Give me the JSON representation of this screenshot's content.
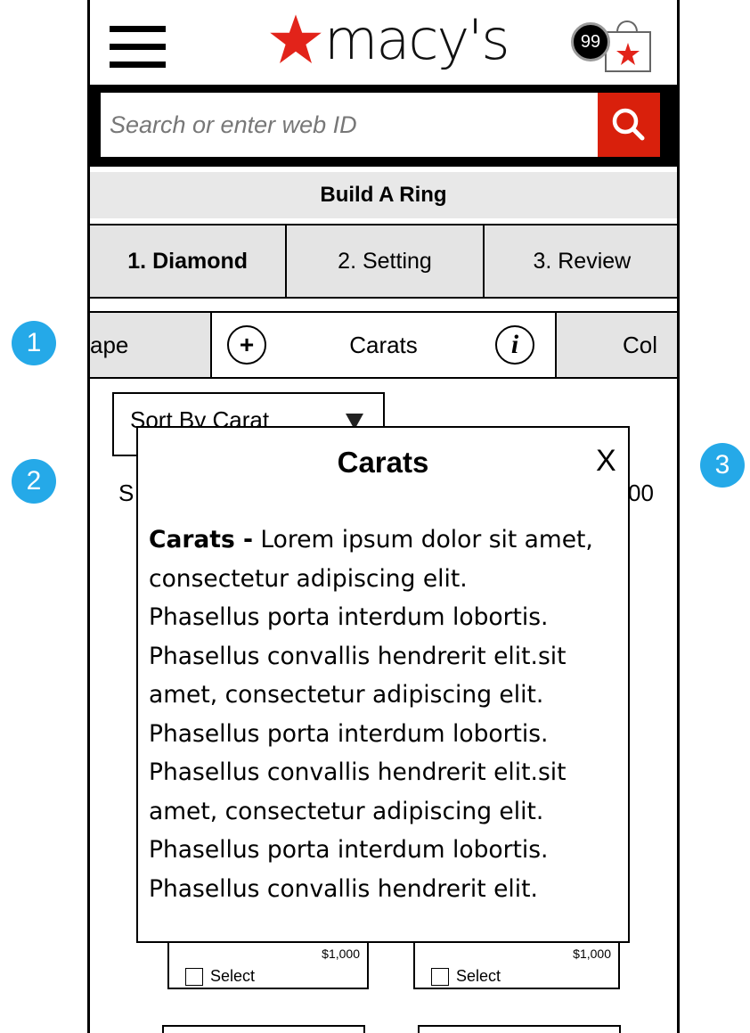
{
  "header": {
    "logo_text": "macy's",
    "bag_count": "99",
    "brand_red": "#d9200c"
  },
  "search": {
    "placeholder": "Search or enter web ID"
  },
  "page_title": "Build A Ring",
  "steps": [
    "1. Diamond",
    "2. Setting",
    "3. Review"
  ],
  "filters": {
    "shape_partial": "ape",
    "carats_label": "Carats",
    "color_partial": "Col"
  },
  "sort": {
    "label": "Sort By Carat"
  },
  "peek": {
    "left": "S",
    "right": "00"
  },
  "modal": {
    "title": "Carats",
    "close_label": "X",
    "lead": "Carats -",
    "lines": [
      " Lorem ipsum dolor sit amet,",
      "consectetur adipiscing elit.",
      "Phasellus porta interdum lobortis.",
      "Phasellus convallis hendrerit elit.sit",
      "amet, consectetur adipiscing elit.",
      "Phasellus porta interdum lobortis.",
      "Phasellus convallis hendrerit elit.sit",
      "amet, consectetur adipiscing elit.",
      "Phasellus porta interdum lobortis.",
      "Phasellus convallis hendrerit elit."
    ]
  },
  "products": [
    {
      "price": "$1,000",
      "select_label": "Select"
    },
    {
      "price": "$1,000",
      "select_label": "Select"
    }
  ],
  "callouts": [
    "1",
    "2",
    "3"
  ],
  "callout_color": "#25a9e8"
}
